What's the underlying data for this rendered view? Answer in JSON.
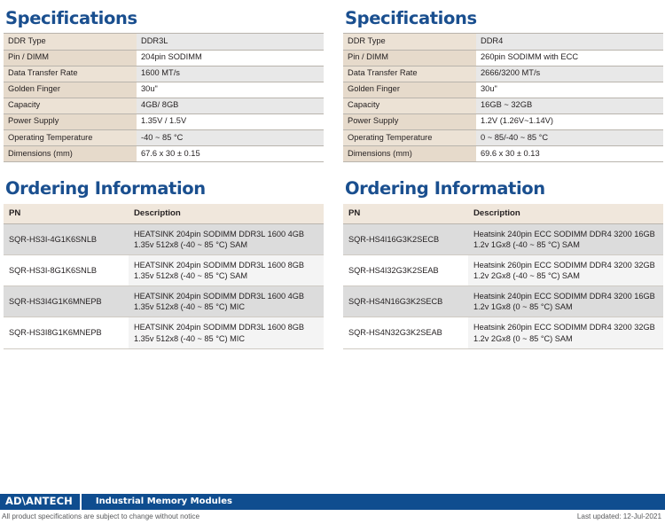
{
  "columns": [
    {
      "spec": {
        "heading": "Specifications",
        "rows": [
          {
            "label": "DDR Type",
            "value": "DDR3L"
          },
          {
            "label": "Pin / DIMM",
            "value": "204pin SODIMM"
          },
          {
            "label": "Data Transfer Rate",
            "value": "1600 MT/s"
          },
          {
            "label": "Golden Finger",
            "value": "30u\""
          },
          {
            "label": "Capacity",
            "value": "4GB/ 8GB"
          },
          {
            "label": "Power Supply",
            "value": "1.35V / 1.5V"
          },
          {
            "label": "Operating Temperature",
            "value": "-40 ~ 85 °C"
          },
          {
            "label": "Dimensions (mm)",
            "value": "67.6 x 30 ± 0.15"
          }
        ]
      },
      "ordering": {
        "heading": "Ordering Information",
        "columns": [
          "PN",
          "Description"
        ],
        "rows": [
          {
            "pn": "SQR-HS3I-4G1K6SNLB",
            "description": "HEATSINK 204pin SODIMM DDR3L 1600 4GB 1.35v 512x8 (-40 ~ 85 °C) SAM"
          },
          {
            "pn": "SQR-HS3I-8G1K6SNLB",
            "description": "HEATSINK 204pin SODIMM DDR3L 1600 8GB 1.35v 512x8 (-40 ~ 85 °C) SAM"
          },
          {
            "pn": "SQR-HS3I4G1K6MNEPB",
            "description": "HEATSINK 204pin SODIMM DDR3L 1600 4GB 1.35v 512x8 (-40 ~ 85 °C) MIC"
          },
          {
            "pn": "SQR-HS3I8G1K6MNEPB",
            "description": "HEATSINK 204pin SODIMM DDR3L 1600 8GB 1.35v 512x8 (-40 ~ 85 °C) MIC"
          }
        ]
      }
    },
    {
      "spec": {
        "heading": "Specifications",
        "rows": [
          {
            "label": "DDR Type",
            "value": "DDR4"
          },
          {
            "label": "Pin / DIMM",
            "value": "260pin SODIMM with ECC"
          },
          {
            "label": "Data Transfer Rate",
            "value": "2666/3200 MT/s"
          },
          {
            "label": "Golden Finger",
            "value": "30u\""
          },
          {
            "label": "Capacity",
            "value": "16GB ~ 32GB"
          },
          {
            "label": "Power Supply",
            "value": "1.2V (1.26V~1.14V)"
          },
          {
            "label": "Operating Temperature",
            "value": "0 ~ 85/-40 ~ 85 °C"
          },
          {
            "label": "Dimensions (mm)",
            "value": "69.6 x 30 ± 0.13"
          }
        ]
      },
      "ordering": {
        "heading": "Ordering Information",
        "columns": [
          "PN",
          "Description"
        ],
        "rows": [
          {
            "pn": "SQR-HS4I16G3K2SECB",
            "description": "Heatsink 240pin ECC SODIMM DDR4 3200 16GB 1.2v 1Gx8 (-40 ~ 85 °C) SAM"
          },
          {
            "pn": "SQR-HS4I32G3K2SEAB",
            "description": "Heatsink 260pin ECC SODIMM DDR4 3200 32GB 1.2v 2Gx8 (-40 ~ 85 °C) SAM"
          },
          {
            "pn": "SQR-HS4N16G3K2SECB",
            "description": "Heatsink 240pin ECC SODIMM DDR4 3200 16GB 1.2v 1Gx8 (0 ~ 85 °C) SAM"
          },
          {
            "pn": "SQR-HS4N32G3K2SEAB",
            "description": "Heatsink 260pin ECC SODIMM DDR4 3200 32GB 1.2v 2Gx8 (0 ~ 85 °C) SAM"
          }
        ]
      }
    }
  ],
  "footer": {
    "logo": "AD\\ANTECH",
    "title": "Industrial Memory Modules",
    "disclaimer": "All product specifications are subject to change without notice",
    "last_updated": "Last updated: 12-Jul-2021",
    "bar_color": "#0f4d8f"
  },
  "theme": {
    "heading_blue": "#1a4f8f",
    "spec_label_bg": "#ece2d5",
    "spec_value_alt_bg": "#e8e8e8",
    "order_header_bg": "#f0e7dc",
    "order_row_alt_bg": "#dcdcdc"
  }
}
